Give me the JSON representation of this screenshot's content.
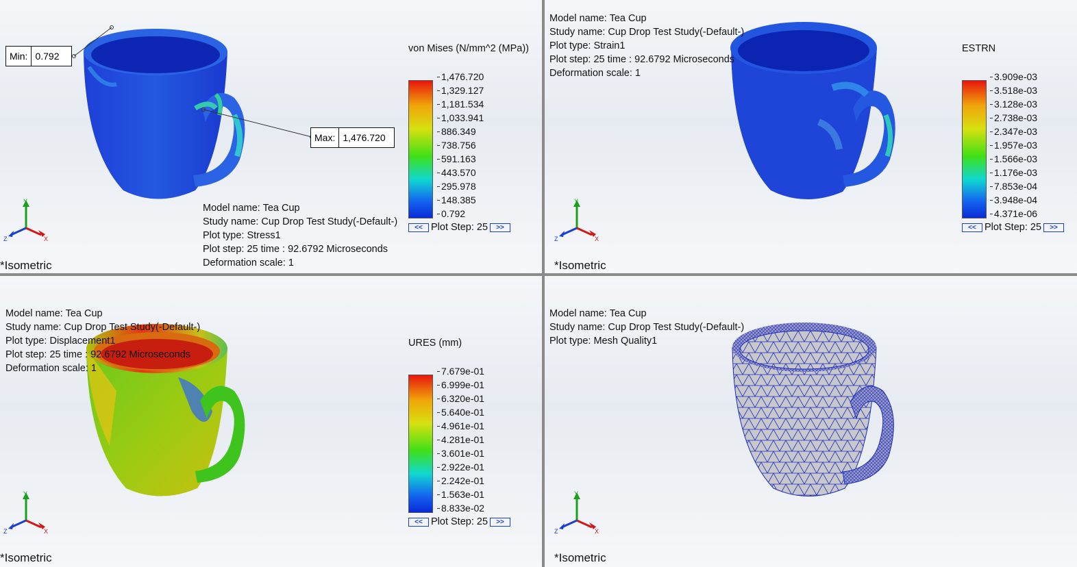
{
  "common": {
    "view_label": "*Isometric",
    "axis_x": "X",
    "axis_y": "Y",
    "axis_z": "Z",
    "step_prev": "<<",
    "step_next": ">>"
  },
  "stress": {
    "model": "Model name: Tea Cup",
    "study": "Study name: Cup Drop Test Study(-Default-)",
    "plot_type": "Plot type:  Stress1",
    "plot_step": "Plot step: 25   time : 92.6792 Microseconds",
    "deformation": "Deformation scale: 1",
    "scale_title": "von Mises (N/mm^2 (MPa))",
    "ticks": [
      "1,476.720",
      "1,329.127",
      "1,181.534",
      "1,033.941",
      "886.349",
      "738.756",
      "591.163",
      "443.570",
      "295.978",
      "148.385",
      "0.792"
    ],
    "step_label": "Plot Step: 25",
    "min_label": "Min:",
    "min_value": "0.792",
    "max_label": "Max:",
    "max_value": "1,476.720"
  },
  "strain": {
    "model": "Model name: Tea Cup",
    "study": "Study name: Cup Drop Test Study(-Default-)",
    "plot_type": "Plot type:  Strain1",
    "plot_step": "Plot step: 25    time : 92.6792 Microseconds",
    "deformation": "Deformation scale: 1",
    "scale_title": "ESTRN",
    "ticks": [
      "3.909e-03",
      "3.518e-03",
      "3.128e-03",
      "2.738e-03",
      "2.347e-03",
      "1.957e-03",
      "1.566e-03",
      "1.176e-03",
      "7.853e-04",
      "3.948e-04",
      "4.371e-06"
    ],
    "step_label": "Plot Step: 25"
  },
  "displacement": {
    "model": "Model name: Tea Cup",
    "study": "Study name: Cup Drop Test Study(-Default-)",
    "plot_type": "Plot type:  Displacement1",
    "plot_step": "Plot step: 25    time : 92.6792 Microseconds",
    "deformation": "Deformation scale: 1",
    "scale_title": "URES (mm)",
    "ticks": [
      "7.679e-01",
      "6.999e-01",
      "6.320e-01",
      "5.640e-01",
      "4.961e-01",
      "4.281e-01",
      "3.601e-01",
      "2.922e-01",
      "2.242e-01",
      "1.563e-01",
      "8.833e-02"
    ],
    "step_label": "Plot Step: 25"
  },
  "mesh": {
    "model": "Model name: Tea Cup",
    "study": "Study name: Cup Drop Test Study(-Default-)",
    "plot_type": "Plot type: Mesh Quality1"
  },
  "colors": {
    "legend_high": "#e8160e",
    "legend_low": "#0a2ad8",
    "mesh_line": "#1a2bb8",
    "step_button": "#1a3fd0"
  }
}
